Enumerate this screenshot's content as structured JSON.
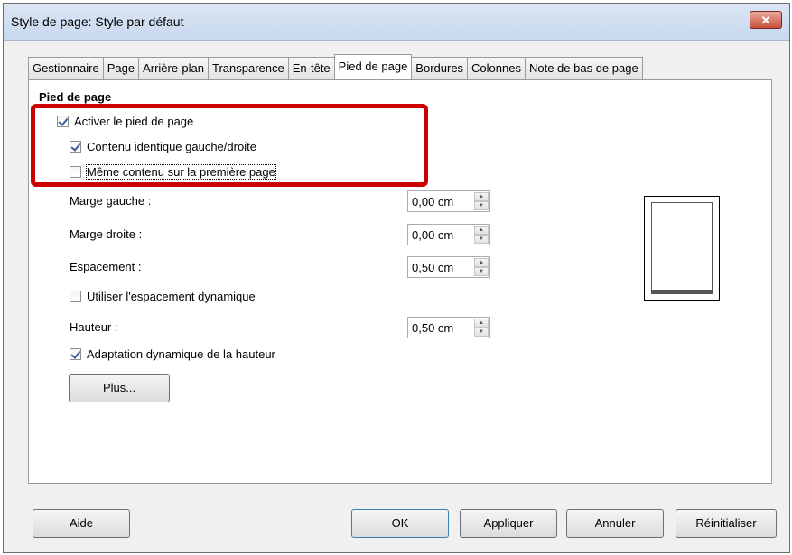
{
  "window": {
    "title": "Style de page: Style par défaut",
    "close_icon": "✕"
  },
  "tabs": [
    {
      "label": "Gestionnaire",
      "active": false
    },
    {
      "label": "Page",
      "active": false
    },
    {
      "label": "Arrière-plan",
      "active": false
    },
    {
      "label": "Transparence",
      "active": false
    },
    {
      "label": "En-tête",
      "active": false
    },
    {
      "label": "Pied de page",
      "active": true
    },
    {
      "label": "Bordures",
      "active": false
    },
    {
      "label": "Colonnes",
      "active": false
    },
    {
      "label": "Note de bas de page",
      "active": false
    }
  ],
  "footer": {
    "section_title": "Pied de page",
    "enable": {
      "label": "Activer le pied de page",
      "checked": true
    },
    "same_left_right": {
      "label": "Contenu identique gauche/droite",
      "checked": true
    },
    "same_first_page": {
      "label": "Même contenu sur la première page",
      "checked": false
    },
    "left_margin": {
      "label": "Marge gauche :",
      "value": "0,00 cm"
    },
    "right_margin": {
      "label": "Marge droite :",
      "value": "0,00 cm"
    },
    "spacing": {
      "label": "Espacement :",
      "value": "0,50 cm"
    },
    "dynamic_spacing": {
      "label": "Utiliser l'espacement dynamique",
      "checked": false
    },
    "height": {
      "label": "Hauteur :",
      "value": "0,50 cm"
    },
    "autofit_height": {
      "label": "Adaptation dynamique de la hauteur",
      "checked": true
    },
    "more_button": "Plus..."
  },
  "buttons": {
    "help": "Aide",
    "ok": "OK",
    "apply": "Appliquer",
    "cancel": "Annuler",
    "reset": "Réinitialiser"
  },
  "colors": {
    "highlight": "#cc0000",
    "titlebar": "#c8d8ee"
  }
}
